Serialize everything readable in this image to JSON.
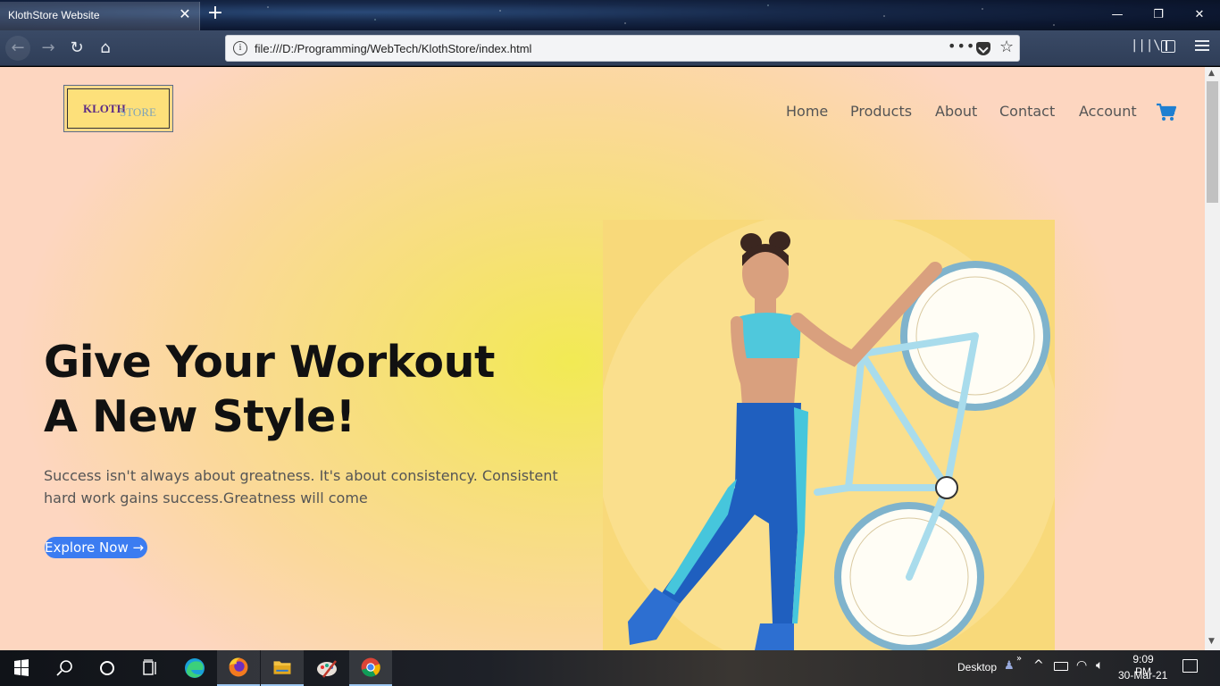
{
  "browser": {
    "tab_title": "KlothStore Website",
    "url": "file:///D:/Programming/WebTech/KlothStore/index.html"
  },
  "site": {
    "logo": {
      "part1": "KLOTH",
      "part2": "STORE"
    },
    "nav": {
      "home": "Home",
      "products": "Products",
      "about": "About",
      "contact": "Contact",
      "account": "Account"
    },
    "hero": {
      "title_line1": "Give Your Workout",
      "title_line2": "A New Style!",
      "text": "Success isn't always about greatness. It's about consistency. Consistent hard work gains success.Greatness will come",
      "button": "Explore Now →"
    },
    "colors": {
      "accent_button": "#3b7cf1",
      "cart": "#1e7fd1"
    }
  },
  "taskbar": {
    "desktop_label": "Desktop",
    "time": "9:09 PM",
    "date": "30-Mar-21",
    "pinned": [
      "windows-start-icon",
      "search-icon",
      "cortana-icon",
      "task-view-icon",
      "edge-icon",
      "firefox-icon",
      "file-explorer-icon",
      "paint-icon",
      "chrome-icon"
    ]
  }
}
